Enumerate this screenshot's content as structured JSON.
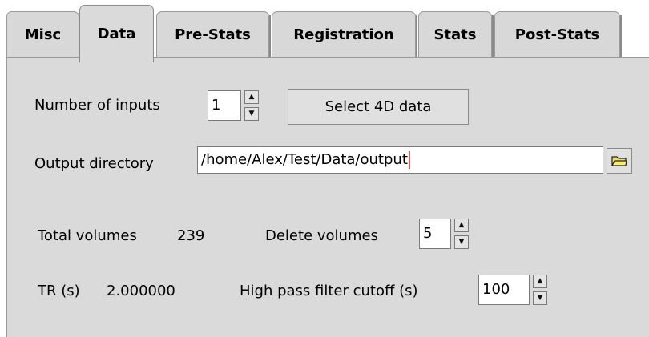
{
  "tabs": [
    {
      "label": "Misc",
      "active": false
    },
    {
      "label": "Data",
      "active": true
    },
    {
      "label": "Pre-Stats",
      "active": false
    },
    {
      "label": "Registration",
      "active": false
    },
    {
      "label": "Stats",
      "active": false
    },
    {
      "label": "Post-Stats",
      "active": false
    }
  ],
  "data_panel": {
    "number_of_inputs_label": "Number of inputs",
    "number_of_inputs_value": "1",
    "select_4d_button": "Select 4D data",
    "output_directory_label": "Output directory",
    "output_directory_value": "/home/Alex/Test/Data/output",
    "folder_icon": "folder-icon",
    "total_volumes_label": "Total volumes",
    "total_volumes_value": "239",
    "delete_volumes_label": "Delete volumes",
    "delete_volumes_value": "5",
    "tr_label": "TR (s)",
    "tr_value": "2.000000",
    "high_pass_label": "High pass filter cutoff (s)",
    "high_pass_value": "100"
  },
  "colors": {
    "panel_bg": "#dadada",
    "tab_bg": "#d8d8d8",
    "caret": "#e85a5a",
    "folder_yellow": "#f2e24a"
  }
}
